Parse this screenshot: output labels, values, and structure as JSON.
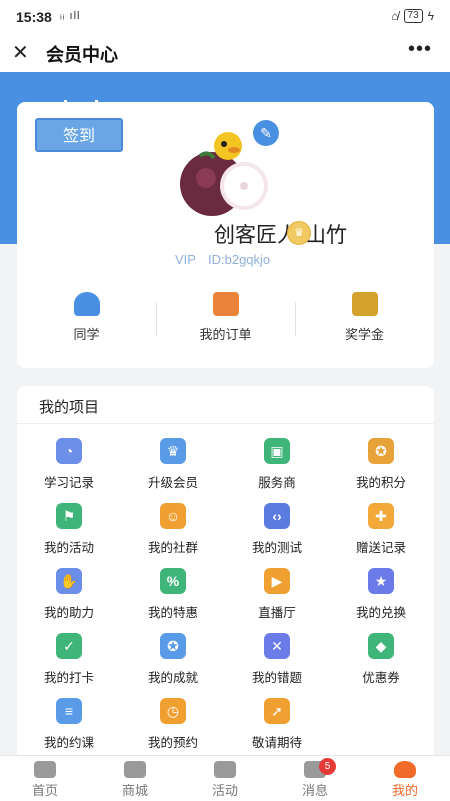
{
  "status_bar": {
    "time": "15:38",
    "signal": "ᵢᵢ ıll",
    "battery": "73"
  },
  "header": {
    "title": "会员中心",
    "close_icon": "close-icon",
    "more_icon": "more-icon"
  },
  "profile": {
    "signin_label": "签到",
    "username": "创客匠人-山竹",
    "vip_label": "VIP",
    "user_id": "ID:b2gqkjo",
    "quick_links": [
      {
        "label": "同学",
        "icon": "classmates-icon",
        "color": "#4a90e2"
      },
      {
        "label": "我的订单",
        "icon": "orders-icon",
        "color": "#e9843a"
      },
      {
        "label": "奖学金",
        "icon": "scholarship-icon",
        "color": "#d4a22a"
      }
    ]
  },
  "projects": {
    "title": "我的项目",
    "items": [
      {
        "label": "学习记录",
        "icon": "clock-icon",
        "color": "#6b8ee8",
        "glyph": "◔"
      },
      {
        "label": "升级会员",
        "icon": "crown-icon",
        "color": "#5a9be8",
        "glyph": "♛"
      },
      {
        "label": "服务商",
        "icon": "briefcase-icon",
        "color": "#3fb57a",
        "glyph": "▣"
      },
      {
        "label": "我的积分",
        "icon": "medal-icon",
        "color": "#e8a23a",
        "glyph": "✪"
      },
      {
        "label": "我的活动",
        "icon": "flag-icon",
        "color": "#3fb57a",
        "glyph": "⚑"
      },
      {
        "label": "我的社群",
        "icon": "group-icon",
        "color": "#f0a030",
        "glyph": "☺"
      },
      {
        "label": "我的测试",
        "icon": "code-icon",
        "color": "#5a7be0",
        "glyph": "‹›"
      },
      {
        "label": "赠送记录",
        "icon": "gift-icon",
        "color": "#f2a93a",
        "glyph": "✚"
      },
      {
        "label": "我的助力",
        "icon": "thumbs-up-icon",
        "color": "#6b8ee8",
        "glyph": "✋"
      },
      {
        "label": "我的特惠",
        "icon": "discount-icon",
        "color": "#3fb57a",
        "glyph": "%"
      },
      {
        "label": "直播厅",
        "icon": "live-icon",
        "color": "#f0a030",
        "glyph": "▶"
      },
      {
        "label": "我的兑换",
        "icon": "shop-icon",
        "color": "#6b7be8",
        "glyph": "★"
      },
      {
        "label": "我的打卡",
        "icon": "calendar-check-icon",
        "color": "#3fb57a",
        "glyph": "✓"
      },
      {
        "label": "我的成就",
        "icon": "achievement-icon",
        "color": "#5a9be8",
        "glyph": "✪"
      },
      {
        "label": "我的错题",
        "icon": "notebook-icon",
        "color": "#6b7be8",
        "glyph": "✕"
      },
      {
        "label": "优惠券",
        "icon": "coupon-icon",
        "color": "#3fb57a",
        "glyph": "◆"
      },
      {
        "label": "我的约课",
        "icon": "document-icon",
        "color": "#5a9be8",
        "glyph": "≡"
      },
      {
        "label": "我的预约",
        "icon": "appointment-icon",
        "color": "#f0a030",
        "glyph": "◷"
      },
      {
        "label": "敬请期待",
        "icon": "rocket-icon",
        "color": "#f0a030",
        "glyph": "➚"
      }
    ]
  },
  "tabbar": {
    "items": [
      {
        "label": "首页",
        "icon": "home-icon"
      },
      {
        "label": "商城",
        "icon": "store-icon"
      },
      {
        "label": "活动",
        "icon": "gift-icon"
      },
      {
        "label": "消息",
        "icon": "bell-icon",
        "badge": "5"
      },
      {
        "label": "我的",
        "icon": "user-icon",
        "active": true
      }
    ]
  }
}
